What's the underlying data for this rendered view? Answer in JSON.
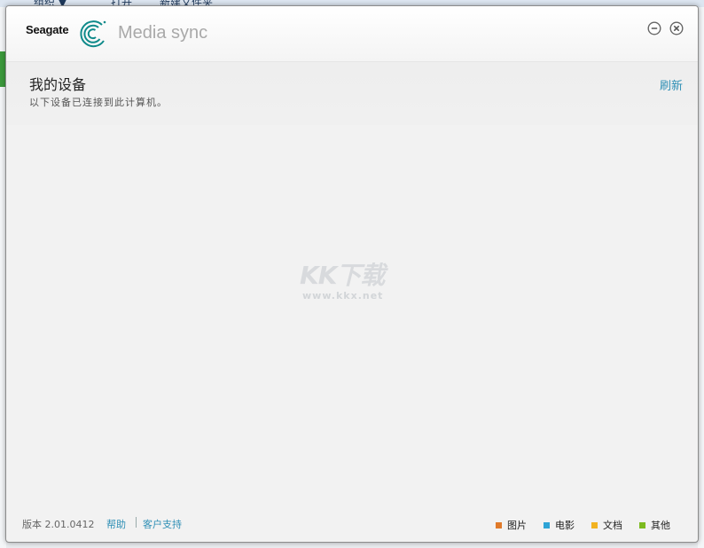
{
  "background": {
    "toolbar_items": [
      "组织 ▼",
      "打开",
      "新建文件夹"
    ]
  },
  "window": {
    "brand": "Seagate",
    "app_name": "Media sync",
    "controls": {
      "minimize": "minimize-icon",
      "close": "close-icon"
    }
  },
  "header": {
    "title": "我的设备",
    "subtitle": "以下设备已连接到此计算机。",
    "refresh": "刷新"
  },
  "watermark": {
    "text": "KK下载",
    "url": "www.kkx.net"
  },
  "footer": {
    "version": "版本 2.01.0412",
    "help": "帮助",
    "support": "客户支持",
    "legend": [
      {
        "label": "图片",
        "color": "#e07a2a"
      },
      {
        "label": "电影",
        "color": "#2fa4d6"
      },
      {
        "label": "文档",
        "color": "#f2b321"
      },
      {
        "label": "其他",
        "color": "#7cba1f"
      }
    ]
  },
  "colors": {
    "accent": "#2e8fb5",
    "logo": "#0f8a8a"
  }
}
